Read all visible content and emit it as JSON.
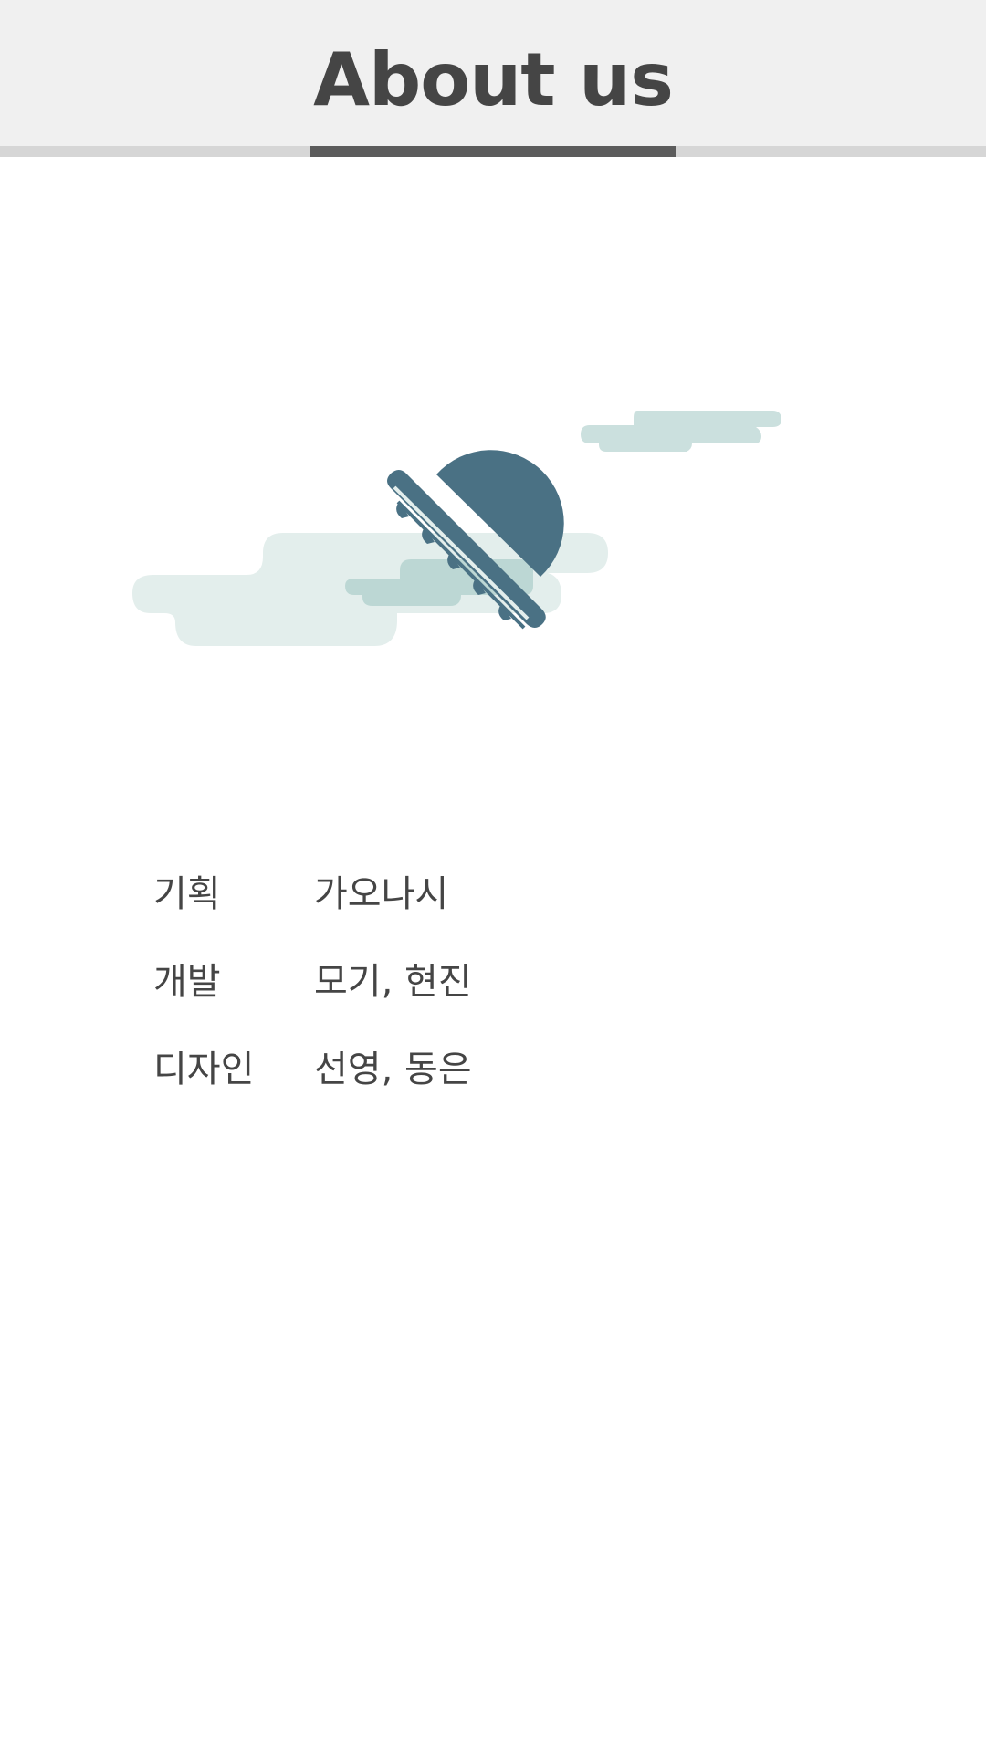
{
  "header": {
    "title": "About us"
  },
  "tabs": {
    "active_index": 1,
    "count": 3
  },
  "illustration": {
    "icon": "ufo-sun-icon",
    "colors": {
      "sun": "#4a7184",
      "cloud_light": "#e3eeec",
      "cloud_mid": "#cbe0de",
      "cloud_dark": "#bcd7d4"
    }
  },
  "credits": [
    {
      "role": "기획",
      "names": "가오나시"
    },
    {
      "role": "개발",
      "names": "모기, 현진"
    },
    {
      "role": "디자인",
      "names": "선영, 동은"
    }
  ],
  "colors": {
    "header_bg": "#f0f0f0",
    "text": "#454545",
    "tab_active": "#5c5c5c",
    "tab_inactive": "#d6d6d6"
  }
}
